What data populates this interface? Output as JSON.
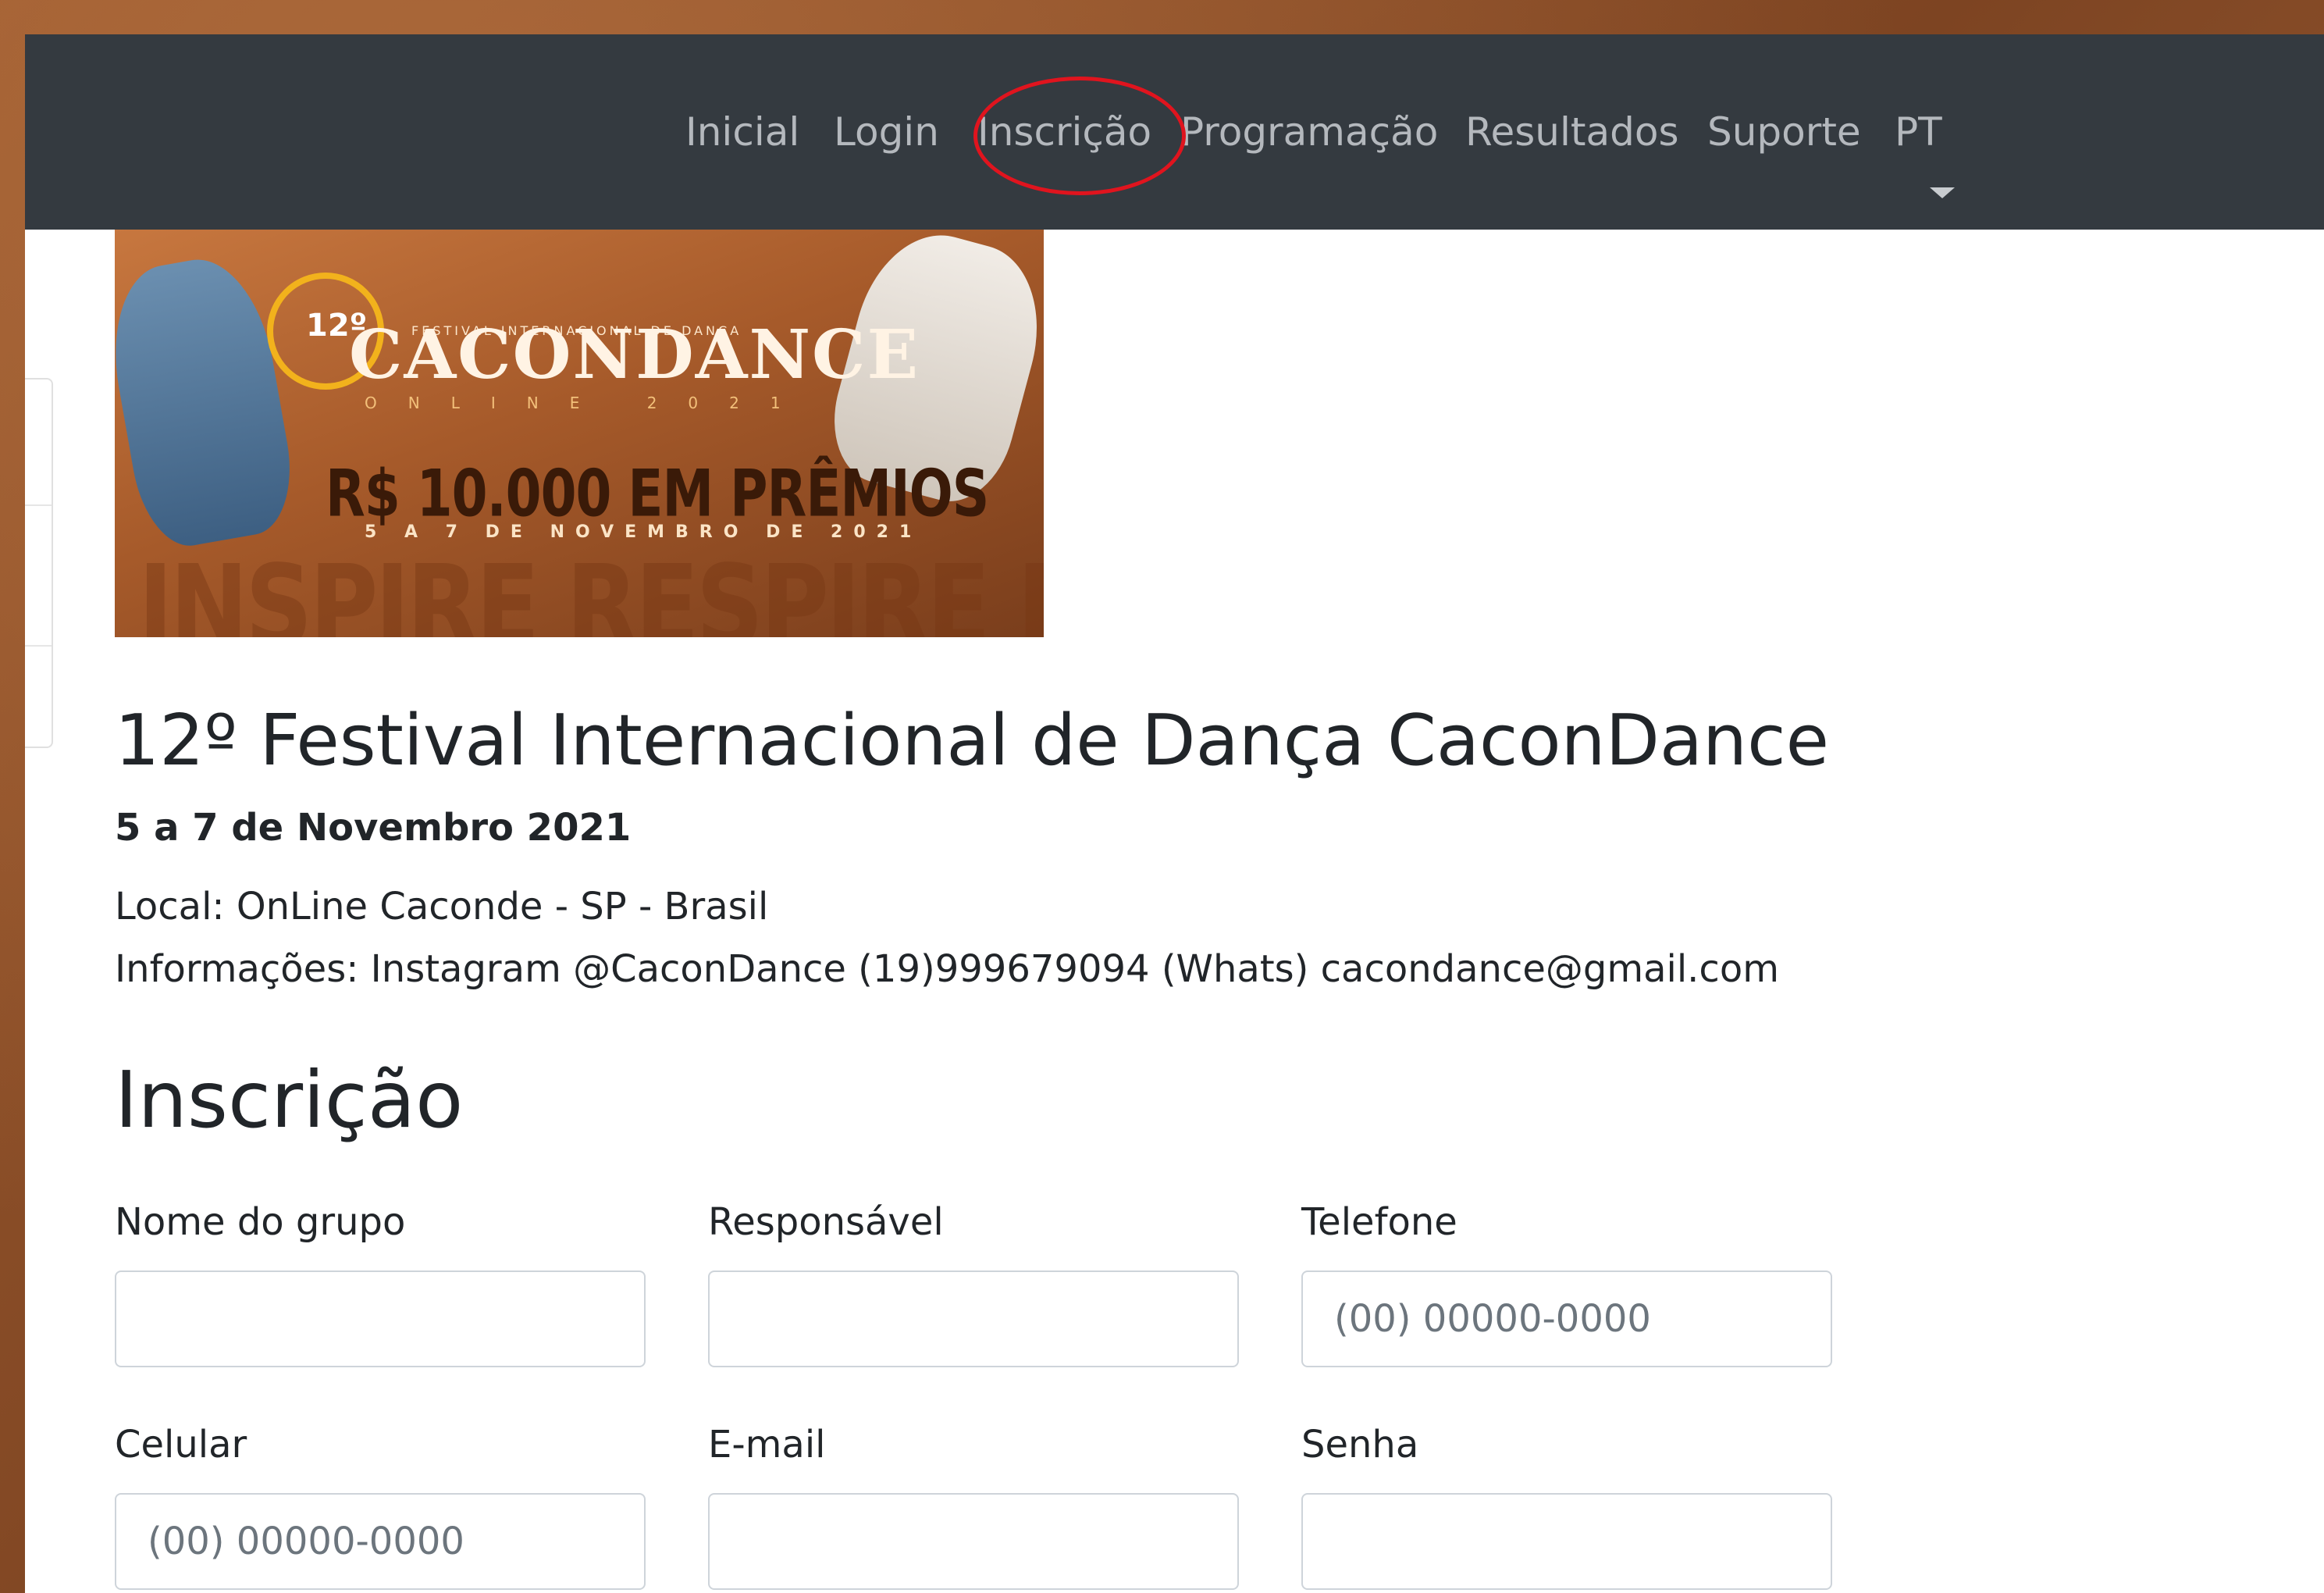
{
  "nav": {
    "items": [
      "Inicial",
      "Login",
      "Inscrição",
      "Programação",
      "Resultados",
      "Suporte",
      "PT"
    ],
    "active": "Inscrição"
  },
  "banner": {
    "number": "12º",
    "subtitle": "FESTIVAL INTERNACIONAL DE DANÇA",
    "logo": "CACONDANCE",
    "online": "ONLINE 2021",
    "prize": "R$ 10.000 EM PRÊMIOS",
    "dates": "5 A 7 DE NOVEMBRO DE 2021",
    "watermark": "INSPIRE RESPIRE DANCE"
  },
  "event": {
    "title": "12º Festival Internacional de Dança CaconDance",
    "dates": "5 a 7 de Novembro 2021",
    "location": "Local: OnLine Caconde - SP - Brasil",
    "info": "Informações: Instagram @CaconDance (19)999679094 (Whats) cacondance@gmail.com"
  },
  "form": {
    "heading": "Inscrição",
    "fields": [
      {
        "label": "Nome do grupo",
        "value": "",
        "placeholder": ""
      },
      {
        "label": "Responsável",
        "value": "",
        "placeholder": ""
      },
      {
        "label": "Telefone",
        "value": "",
        "placeholder": "(00) 00000-0000"
      },
      {
        "label": "Celular",
        "value": "",
        "placeholder": "(00) 00000-0000"
      },
      {
        "label": "E-mail",
        "value": "",
        "placeholder": ""
      },
      {
        "label": "Senha",
        "value": "",
        "placeholder": ""
      }
    ]
  },
  "colors": {
    "navbar": "#343a40",
    "nav_text": "#b4b8bd",
    "highlight_circle": "#e0141e",
    "text": "#212529"
  }
}
